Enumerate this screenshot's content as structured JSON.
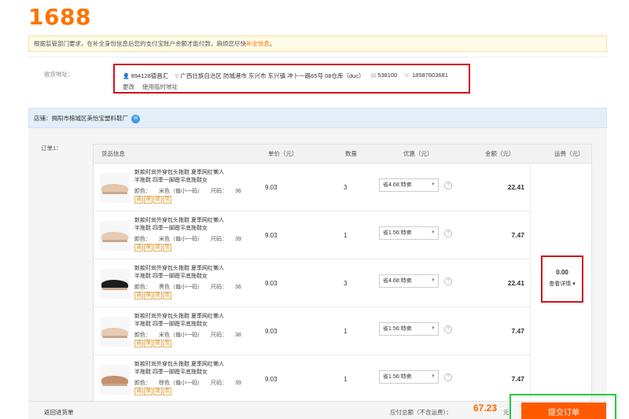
{
  "logo": "1688",
  "notice": {
    "text": "根据监管部门要求，在补全身份信息后您的支付宝账户余额才能付款，麻烦您尽快",
    "link": "补全信息",
    "end": "。"
  },
  "address": {
    "label": "收货地址：",
    "name": "894128德昌汇",
    "region": "广西壮族自治区 防城港市 东兴市 东兴镇 冲卜一路65号 08仓库（duc）",
    "postcode": "538100",
    "phone": "18587603681",
    "change": "更改",
    "temp": "使用临时地址"
  },
  "shop": {
    "name": "店铺：揭阳市榕城区美怡宝塑料鞋厂"
  },
  "order": {
    "label": "订单1：",
    "headers": {
      "goods": "货品信息",
      "price": "单价（元）",
      "qty": "数量",
      "discount": "优惠（元）",
      "amount": "金额（元）",
      "shipping": "运费（元）"
    },
    "color_label": "颜色：",
    "size_label": "尺码：",
    "badges": [
      "诚",
      "保",
      "现",
      "货"
    ],
    "items": [
      {
        "title": "新款时尚外穿包头拖鞋 夏季网红懒人半拖鞋 四季一脚蹬平底拖鞋女",
        "color": "米色（偏小一码）",
        "size": "36",
        "price": "9.03",
        "qty": "3",
        "discount": "省4.68:特卖",
        "amount": "22.41",
        "shoe_color": "#e3c6ac"
      },
      {
        "title": "新款时尚外穿包头拖鞋 夏季网红懒人半拖鞋 四季一脚蹬平底拖鞋女",
        "color": "米色（偏小一码）",
        "size": "39",
        "price": "9.03",
        "qty": "1",
        "discount": "省1.56:特卖",
        "amount": "7.47",
        "shoe_color": "#e6ccb5"
      },
      {
        "title": "新款时尚外穿包头拖鞋 夏季网红懒人半拖鞋 四季一脚蹬平底拖鞋女",
        "color": "黑色（偏小一码）",
        "size": "36",
        "price": "9.03",
        "qty": "3",
        "discount": "省4.68:特卖",
        "amount": "22.41",
        "shoe_color": "#1c1c1c"
      },
      {
        "title": "新款时尚外穿包头拖鞋 夏季网红懒人半拖鞋 四季一脚蹬平底拖鞋女",
        "color": "米色（偏小一码）",
        "size": "38",
        "price": "9.03",
        "qty": "1",
        "discount": "省1.56:特卖",
        "amount": "7.47",
        "shoe_color": "#e6ccb5"
      },
      {
        "title": "新款时尚外穿包头拖鞋 夏季网红懒人半拖鞋 四季一脚蹬平底拖鞋女",
        "color": "棕色（偏小一码）",
        "size": "39",
        "price": "9.03",
        "qty": "1",
        "discount": "省1.56:特卖",
        "amount": "7.47",
        "shoe_color": "#c58f6e"
      }
    ],
    "shipping": {
      "value": "0.00",
      "detail": "查看详情 ▾"
    }
  },
  "footer": {
    "back": "返回进货单",
    "total_label": "应付总额（不含运费）：",
    "total_value": "67.23",
    "total_unit": "元",
    "submit": "提交订单"
  }
}
